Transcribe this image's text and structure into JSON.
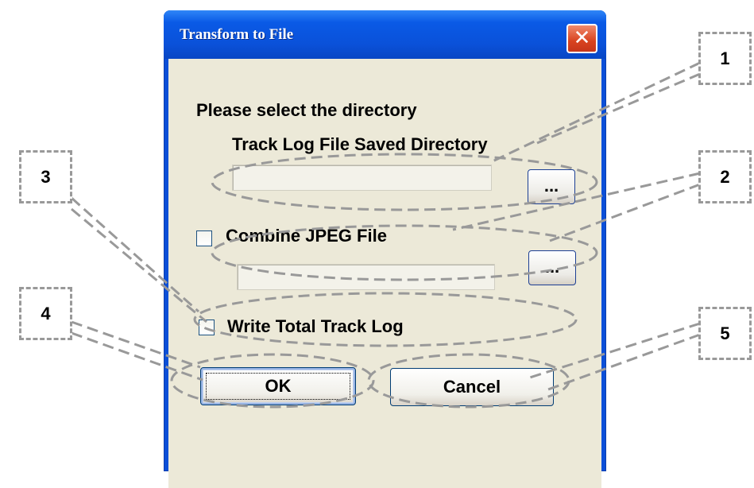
{
  "window": {
    "title": "Transform to File",
    "close_glyph": "✕"
  },
  "dialog": {
    "instruction": "Please select the directory",
    "track_log_dir_label": "Track Log File Saved Directory",
    "track_log_dir_value": "",
    "browse_label": "...",
    "combine_jpeg_label": "Combine JPEG File",
    "combine_jpeg_checked": false,
    "jpeg_dir_value": "",
    "write_total_label": "Write Total Track Log",
    "write_total_checked": false,
    "ok_label": "OK",
    "cancel_label": "Cancel"
  },
  "callouts": [
    "1",
    "2",
    "3",
    "4",
    "5"
  ],
  "colors": {
    "titlebar": "#0a51d9",
    "client_bg": "#ece9d8",
    "close_button": "#d8431f",
    "callout_dash": "#999999"
  }
}
